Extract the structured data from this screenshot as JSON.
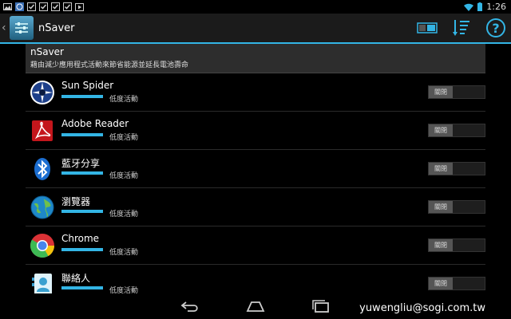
{
  "status_bar": {
    "notifications": [
      "image-icon",
      "circle-app-icon",
      "download-done-icon",
      "download-done-icon",
      "download-done-icon",
      "download-done-icon",
      "play-store-icon"
    ],
    "time": "1:26"
  },
  "action_bar": {
    "title": "nSaver",
    "actions": [
      "toggle-view-icon",
      "sort-icon",
      "help-icon"
    ]
  },
  "header": {
    "title": "nSaver",
    "subtitle": "藉由減少應用程式活動來節省能源並延長電池壽命"
  },
  "apps": [
    {
      "name": "Sun Spider",
      "status": "低度活動",
      "toggle": "關閉",
      "icon": "sun-spider-icon"
    },
    {
      "name": "Adobe Reader",
      "status": "低度活動",
      "toggle": "關閉",
      "icon": "adobe-reader-icon"
    },
    {
      "name": "藍牙分享",
      "status": "低度活動",
      "toggle": "關閉",
      "icon": "bluetooth-icon"
    },
    {
      "name": "瀏覽器",
      "status": "低度活動",
      "toggle": "關閉",
      "icon": "browser-globe-icon"
    },
    {
      "name": "Chrome",
      "status": "低度活動",
      "toggle": "關閉",
      "icon": "chrome-icon"
    },
    {
      "name": "聯絡人",
      "status": "低度活動",
      "toggle": "關閉",
      "icon": "contacts-icon"
    }
  ],
  "nav_bar": [
    "back-icon",
    "home-icon",
    "recents-icon"
  ],
  "watermark": "yuwengliu@sogi.com.tw",
  "colors": {
    "accent": "#33b5e5",
    "background": "#000000"
  }
}
